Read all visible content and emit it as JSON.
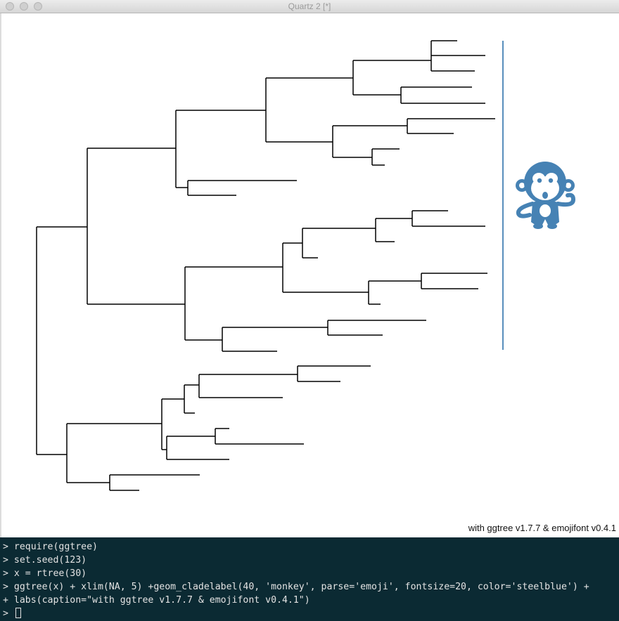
{
  "window": {
    "title": "Quartz 2 [*]"
  },
  "plot": {
    "caption": "with ggtree v1.7.7 & emojifont v0.4.1",
    "clade_color": "#4682b4",
    "emoji_icon": "monkey-icon"
  },
  "console": {
    "lines": [
      "> require(ggtree)",
      "> set.seed(123)",
      "> x = rtree(30)",
      "> ggtree(x) + xlim(NA, 5) +geom_cladelabel(40, 'monkey', parse='emoji', fontsize=20, color='steelblue') +",
      "+ labs(caption=\"with ggtree v1.7.7 & emojifont v0.4.1\")"
    ],
    "prompt": ">"
  }
}
